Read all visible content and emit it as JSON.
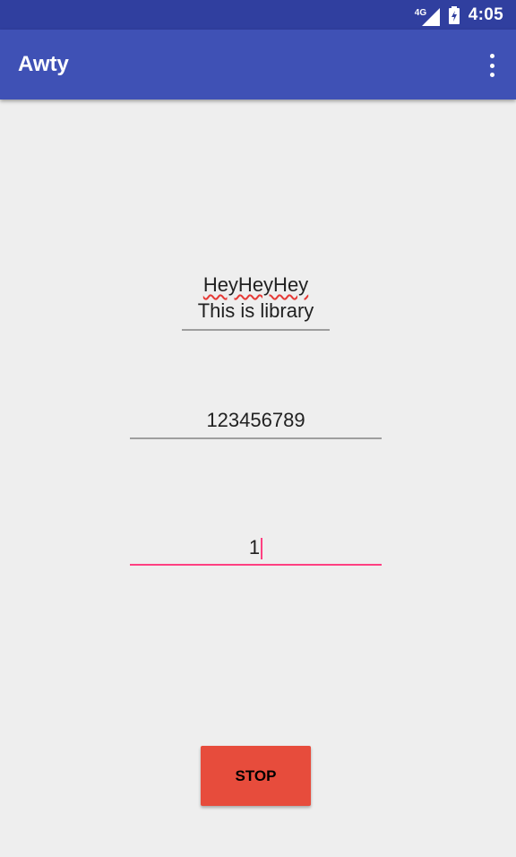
{
  "status_bar": {
    "network": "4G",
    "time": "4:05",
    "icons": [
      "signal-icon",
      "battery-charging-icon"
    ]
  },
  "app_bar": {
    "title": "Awty",
    "menu_icon": "more-vert-icon"
  },
  "form": {
    "message_line1": "HeyHeyHey",
    "message_line2": "This is library",
    "phone_value": "123456789",
    "minutes_value": "1"
  },
  "actions": {
    "stop_label": "STOP"
  },
  "colors": {
    "status_bar": "#303f9f",
    "app_bar": "#3f51b5",
    "background": "#eeeeee",
    "accent": "#ff4081",
    "stop_button": "#e74c3c",
    "spellcheck": "#e53935"
  }
}
